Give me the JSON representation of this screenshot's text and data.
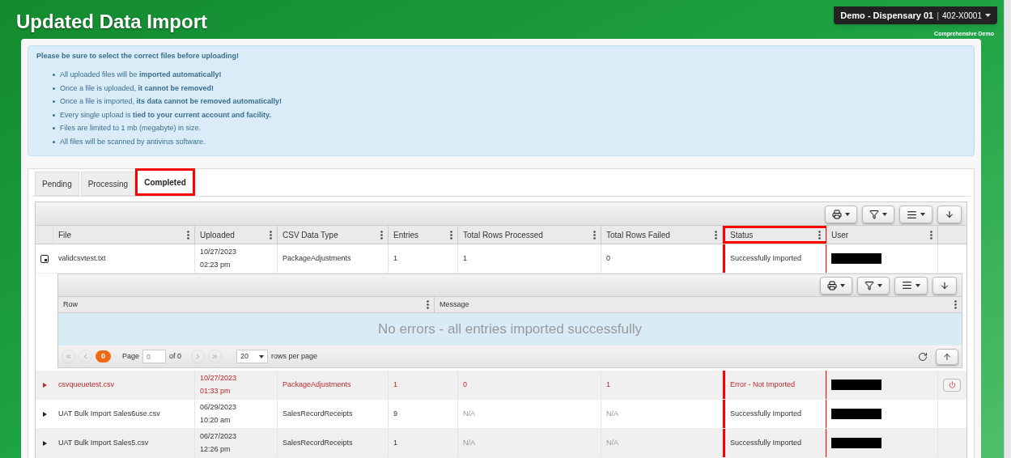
{
  "page_title": "Updated Data Import",
  "account": {
    "name": "Demo - Dispensary 01",
    "separator": "|",
    "license": "402-X0001",
    "subtitle": "Comprehensive Demo"
  },
  "notice": {
    "heading": "Please be sure to select the correct files before uploading!",
    "items": [
      "All uploaded files will be **imported automatically!**",
      "Once a file is uploaded, **it cannot be removed!**",
      "Once a file is imported, **its data cannot be removed automatically!**",
      "Every single upload is **tied to your current account and facility.**",
      "Files are limited to 1 mb (megabyte) in size.",
      "All files will be scanned by antivirus software."
    ]
  },
  "tabs": [
    {
      "label": "Pending",
      "selected": false,
      "highlighted": false
    },
    {
      "label": "Processing",
      "selected": false,
      "highlighted": false
    },
    {
      "label": "Completed",
      "selected": true,
      "highlighted": true
    }
  ],
  "table": {
    "columns": [
      {
        "label": "File",
        "highlighted": false
      },
      {
        "label": "Uploaded",
        "highlighted": false
      },
      {
        "label": "CSV Data Type",
        "highlighted": false
      },
      {
        "label": "Entries",
        "highlighted": false
      },
      {
        "label": "Total Rows Processed",
        "highlighted": false
      },
      {
        "label": "Total Rows Failed",
        "highlighted": false
      },
      {
        "label": "Status",
        "highlighted": true
      },
      {
        "label": "User",
        "highlighted": false
      }
    ],
    "rows": [
      {
        "expanded": true,
        "error": false,
        "file": "validcsvtest.txt",
        "date": "10/27/2023",
        "time": "02:23 pm",
        "type": "PackageAdjustments",
        "entries": "1",
        "processed": "1",
        "failed": "0",
        "counts_na": false,
        "status": "Successfully Imported",
        "user_redacted": true,
        "action": false
      },
      {
        "expanded": false,
        "error": true,
        "file": "csvqueuetest.csv",
        "date": "10/27/2023",
        "time": "01:33 pm",
        "type": "PackageAdjustments",
        "entries": "1",
        "processed": "0",
        "failed": "1",
        "counts_na": false,
        "status": "Error - Not Imported",
        "user_redacted": true,
        "action": true
      },
      {
        "expanded": false,
        "error": false,
        "file": "UAT Bulk Import Sales6use.csv",
        "date": "06/29/2023",
        "time": "10:20 am",
        "type": "SalesRecordReceipts",
        "entries": "9",
        "processed": "N/A",
        "failed": "N/A",
        "counts_na": true,
        "status": "Successfully Imported",
        "user_redacted": true,
        "action": false
      },
      {
        "expanded": false,
        "error": false,
        "file": "UAT Bulk Import Sales5.csv",
        "date": "06/27/2023",
        "time": "12:26 pm",
        "type": "SalesRecordReceipts",
        "entries": "1",
        "processed": "N/A",
        "failed": "N/A",
        "counts_na": true,
        "status": "Successfully Imported",
        "user_redacted": true,
        "action": false
      }
    ]
  },
  "detail": {
    "columns": [
      "Row",
      "Message"
    ],
    "empty_message": "No errors - all entries imported successfully",
    "pager": {
      "current": "0",
      "page_label": "Page",
      "page_value": "0",
      "of_label": "of 0",
      "page_size": "20",
      "size_label": "rows per page"
    }
  }
}
